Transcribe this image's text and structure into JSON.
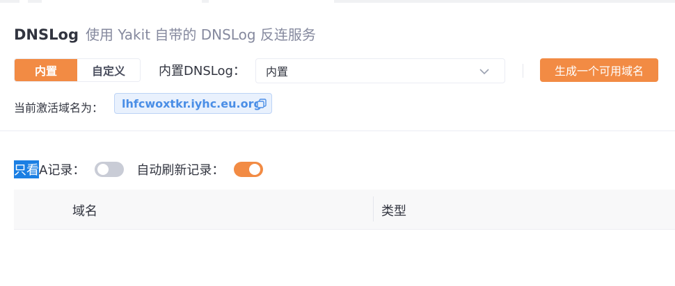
{
  "header": {
    "title": "DNSLog",
    "subtitle": "使用 Yakit 自带的 DNSLog 反连服务"
  },
  "mode_switch": {
    "options": [
      "内置",
      "自定义"
    ],
    "selected": "内置"
  },
  "dnslog_select": {
    "label": "内置DNSLog：",
    "value": "内置"
  },
  "generate_button": {
    "label": "生成一个可用域名"
  },
  "active_domain": {
    "label": "当前激活域名为：",
    "value": "lhfcwoxtkr.iyhc.eu.org"
  },
  "filters": {
    "only_a_highlight": "只看",
    "only_a_rest": "A记录：",
    "only_a_enabled": false,
    "auto_refresh_label": "自动刷新记录：",
    "auto_refresh_enabled": true
  },
  "table": {
    "columns": [
      "域名",
      "类型"
    ]
  },
  "colors": {
    "accent": "#f28b44",
    "link": "#4a8ee6",
    "selection": "#1b7fe3"
  }
}
